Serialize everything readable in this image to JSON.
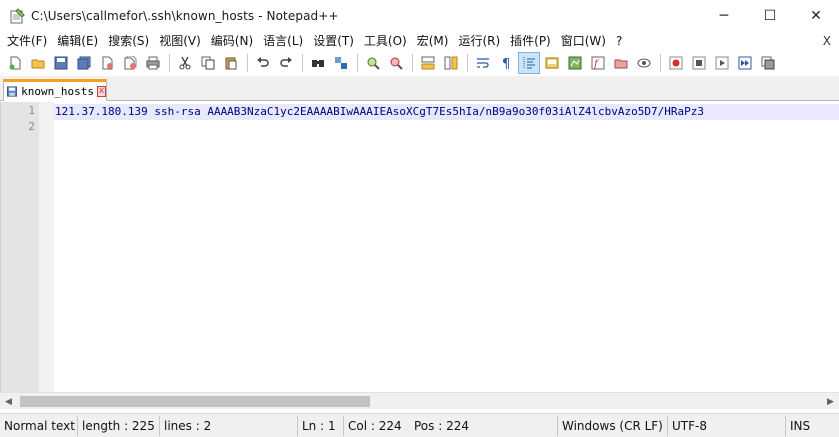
{
  "window": {
    "title": "C:\\Users\\callmefor\\.ssh\\known_hosts - Notepad++",
    "minimize": "─",
    "maximize": "☐",
    "close": "✕"
  },
  "menu": {
    "items": [
      "文件(F)",
      "编辑(E)",
      "搜索(S)",
      "视图(V)",
      "编码(N)",
      "语言(L)",
      "设置(T)",
      "工具(O)",
      "宏(M)",
      "运行(R)",
      "插件(P)",
      "窗口(W)",
      "?"
    ],
    "close_doc": "X"
  },
  "toolbar": {
    "icons": [
      "new-file-icon",
      "open-file-icon",
      "save-icon",
      "save-all-icon",
      "close-icon",
      "close-all-icon",
      "print-icon",
      "cut-icon",
      "copy-icon",
      "paste-icon",
      "undo-icon",
      "redo-icon",
      "find-icon",
      "replace-icon",
      "zoom-in-icon",
      "zoom-out-icon",
      "sync-vertical-icon",
      "sync-horizontal-icon",
      "word-wrap-icon",
      "show-all-chars-icon",
      "indent-guide-icon",
      "udl-icon",
      "doc-map-icon",
      "function-list-icon",
      "folder-workspace-icon",
      "monitor-icon",
      "record-macro-icon",
      "stop-macro-icon",
      "play-macro-icon",
      "run-macro-multiple-icon",
      "save-macro-icon"
    ]
  },
  "tab": {
    "label": "known_hosts",
    "close": "x"
  },
  "editor": {
    "line_numbers": [
      "1",
      "2"
    ],
    "lines": [
      "121.37.180.139 ssh-rsa AAAAB3NzaC1yc2EAAAABIwAAAIEAsoXCgT7Es5hIa/nB9a9o30f03iAlZ4lcbvAzo5D7/HRaPz3",
      ""
    ]
  },
  "status": {
    "type": "Normal text",
    "length": "length : 225",
    "lines": "lines : 2",
    "ln": "Ln : 1",
    "col": "Col : 224",
    "pos": "Pos : 224",
    "eol": "Windows (CR LF)",
    "encoding": "UTF-8",
    "mode": "INS"
  },
  "colors": {
    "tab_accent": "#f7a21b",
    "text": "#000080",
    "current_line": "#e8e8ff"
  }
}
